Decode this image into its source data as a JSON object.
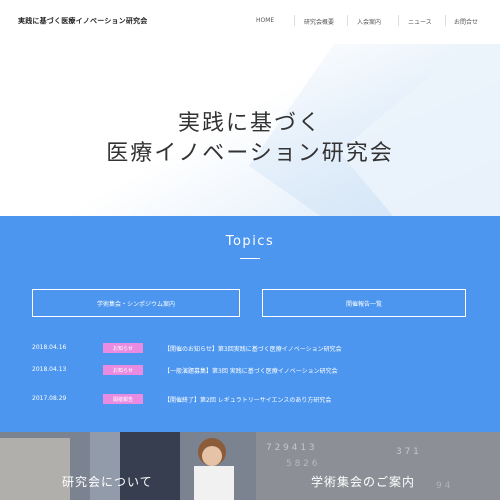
{
  "header": {
    "site_title": "実践に基づく医療イノベーション研究会",
    "nav": [
      "HOME",
      "研究会概要",
      "入会案内",
      "ニュース",
      "お問合せ"
    ]
  },
  "hero": {
    "line1": "実践に基づく",
    "line2": "医療イノベーション研究会"
  },
  "topics": {
    "title": "Topics",
    "buttons": [
      "学術集会・シンポジウム案内",
      "開催報告一覧"
    ],
    "news": [
      {
        "date": "2018.04.16",
        "badge": "お知らせ",
        "text": "【開催のお知らせ】第3回実践に基づく医療イノベーション研究会"
      },
      {
        "date": "2018.04.13",
        "badge": "お知らせ",
        "text": "【一般演題募集】第3回 実践に基づく医療イノベーション研究会"
      },
      {
        "date": "2017.08.29",
        "badge": "開催報告",
        "text": "【開催終了】第2回 レギュラトリーサイエンスのあり方研究会"
      }
    ],
    "colors": {
      "background": "#4c96ef",
      "badge": "#e98be1"
    }
  },
  "panels": {
    "left_label": "研究会について",
    "right_label": "学術集会のご案内"
  }
}
